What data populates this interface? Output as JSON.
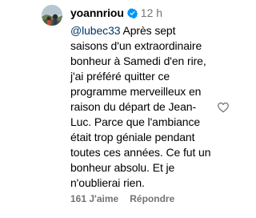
{
  "comment": {
    "username": "yoannriou",
    "verified": true,
    "timestamp": "12 h",
    "mention": "@lubec33",
    "text": " Après sept\nsaisons d'un extraordinaire\nbonheur à Samedi d'en rire,\nj'ai préféré quitter ce\nprogramme merveilleux en\nraison du départ de Jean-\nLuc. Parce que l'ambiance\nétait trop géniale pendant\ntoutes ces années. Ce fut un\nbonheur absolu. Et je\nn'oublierai rien.",
    "likes_label": "161 J'aime",
    "reply_label": "Répondre",
    "like_icon": "heart-outline-icon"
  },
  "colors": {
    "verified": "#0095f6",
    "mention": "#00376b",
    "secondary_text": "#737373"
  }
}
